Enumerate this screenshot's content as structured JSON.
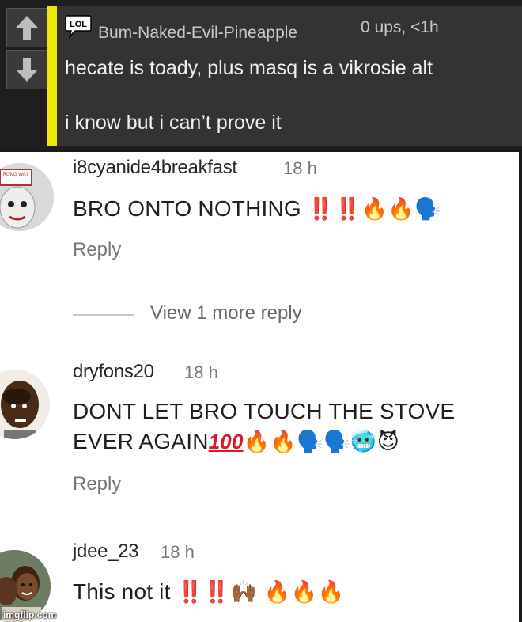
{
  "top_comment": {
    "author": "Bum-Naked-Evil-Pineapple",
    "meta": "0 ups, <1h",
    "badge": "LOL",
    "lines": [
      "hecate is toady, plus masq is a vikrosie alt",
      "i know but i can’t prove it"
    ],
    "accent_color": "#ecea02"
  },
  "comments": [
    {
      "username": "i8cyanide4breakfast",
      "time": "18 h",
      "text": "BRO ONTO  NOTHING",
      "emojis": "‼️‼️🔥🔥🗣️",
      "reply": "Reply",
      "view_more": "View 1 more reply"
    },
    {
      "username": "dryfons20",
      "time": "18 h",
      "text_line1": "DONT LET BRO TOUCH THE STOVE",
      "text_line2": "EVER AGAIN",
      "hundred": "100",
      "emojis": "🔥🔥🗣️🗣️🥶😈",
      "reply": "Reply"
    },
    {
      "username": "jdee_23",
      "time": "18 h",
      "text": "This not it",
      "emojis": "‼️‼️🙌🏾 🔥🔥🔥"
    }
  ],
  "avatar_sign_text": "RONG WAY",
  "watermark": "imgflip.com",
  "icons": [
    "upvote-arrow-icon",
    "downvote-arrow-icon",
    "lol-speech-bubble-icon"
  ]
}
